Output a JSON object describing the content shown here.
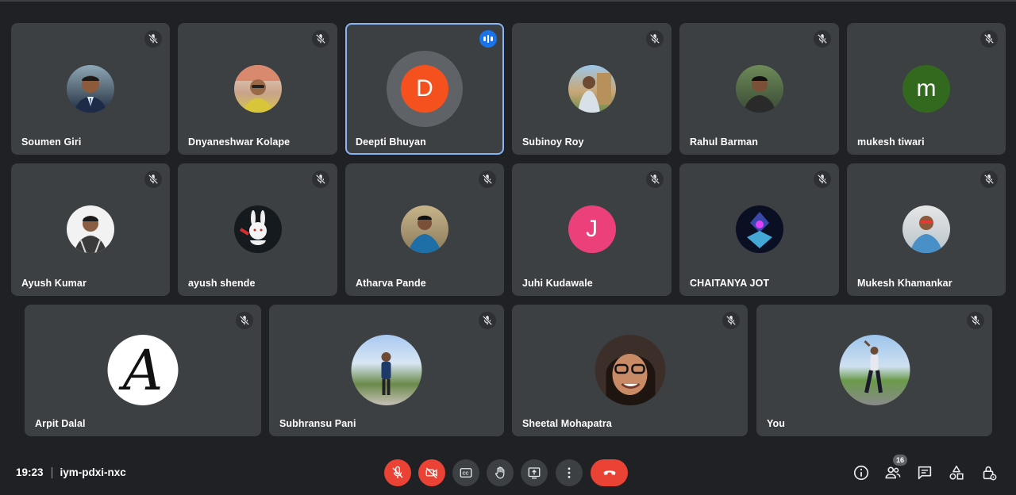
{
  "meeting": {
    "time": "19:23",
    "code": "iym-pdxi-nxc",
    "participant_count": "16"
  },
  "participants": [
    {
      "name": "Soumen Giri",
      "avatar": "photo",
      "muted": true
    },
    {
      "name": "Dnyaneshwar Kolape",
      "avatar": "photo",
      "muted": true
    },
    {
      "name": "Deepti Bhuyan",
      "avatar": "letter",
      "letter": "D",
      "color": "#f4511e",
      "muted": false,
      "speaking": true
    },
    {
      "name": "Subinoy Roy",
      "avatar": "photo",
      "muted": true
    },
    {
      "name": "Rahul Barman",
      "avatar": "photo",
      "muted": true
    },
    {
      "name": "mukesh tiwari",
      "avatar": "letter",
      "letter": "m",
      "color": "#33691e",
      "muted": true
    },
    {
      "name": "Ayush Kumar",
      "avatar": "photo",
      "muted": true
    },
    {
      "name": "ayush shende",
      "avatar": "photo",
      "muted": true
    },
    {
      "name": "Atharva Pande",
      "avatar": "photo",
      "muted": true
    },
    {
      "name": "Juhi Kudawale",
      "avatar": "letter",
      "letter": "J",
      "color": "#ec407a",
      "muted": true
    },
    {
      "name": "CHAITANYA JOT",
      "avatar": "photo",
      "muted": true
    },
    {
      "name": "Mukesh Khamankar",
      "avatar": "photo",
      "muted": true
    },
    {
      "name": "Arpit Dalal",
      "avatar": "logo",
      "letter": "A",
      "muted": true
    },
    {
      "name": "Subhransu Pani",
      "avatar": "photo",
      "muted": true
    },
    {
      "name": "Sheetal Mohapatra",
      "avatar": "photo",
      "muted": true
    },
    {
      "name": "You",
      "avatar": "photo",
      "muted": true
    }
  ],
  "controls": [
    {
      "icon": "mic-off-icon",
      "state": "off"
    },
    {
      "icon": "camera-off-icon",
      "state": "off"
    },
    {
      "icon": "captions-icon"
    },
    {
      "icon": "raise-hand-icon"
    },
    {
      "icon": "present-screen-icon"
    },
    {
      "icon": "more-options-icon"
    },
    {
      "icon": "end-call-icon"
    }
  ],
  "side_controls": [
    {
      "icon": "info-icon"
    },
    {
      "icon": "people-icon"
    },
    {
      "icon": "chat-icon"
    },
    {
      "icon": "activities-icon"
    },
    {
      "icon": "host-controls-icon"
    }
  ],
  "colors": {
    "background": "#202124",
    "tile": "#3c4043",
    "active_border": "#8ab4f8",
    "danger": "#ea4335",
    "speaking_badge": "#1a73e8"
  }
}
